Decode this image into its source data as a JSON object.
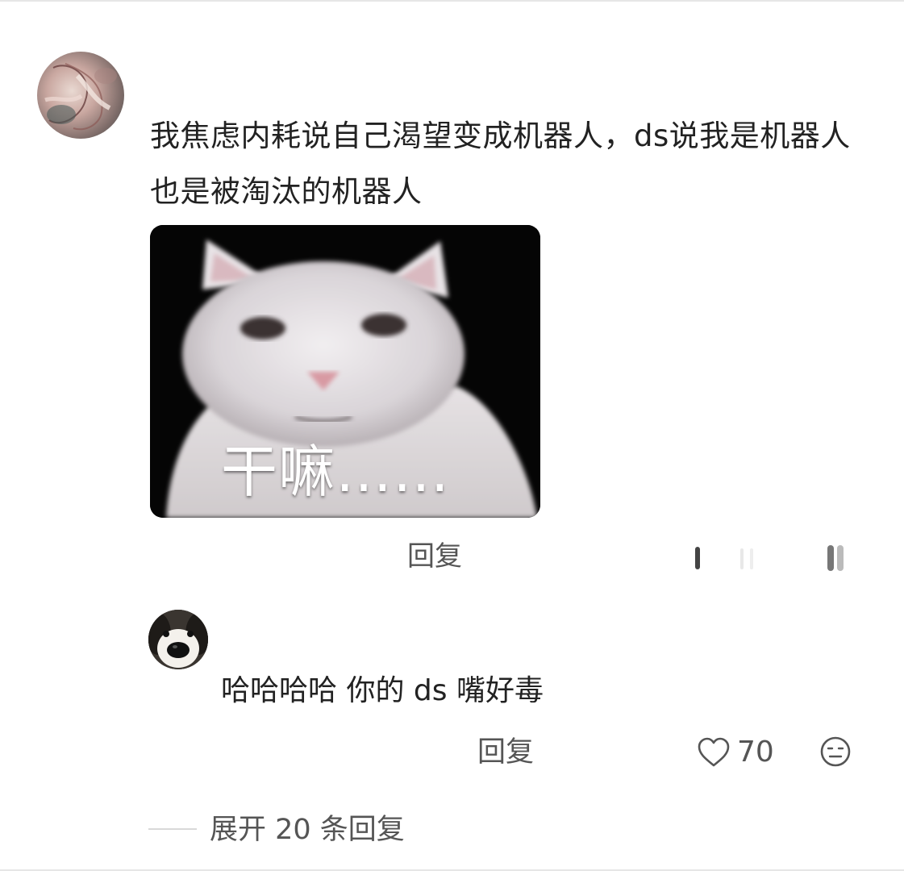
{
  "comment": {
    "avatar_icon": "user-avatar-illustration",
    "text": "我焦虑内耗说自己渴望变成机器人，ds说我是机器人也是被淘汰的机器人",
    "image": {
      "icon": "white-cat-meme",
      "caption": "干嘛……"
    },
    "reply_label": "回复"
  },
  "sub_reply": {
    "avatar_icon": "dog-avatar",
    "text": "哈哈哈哈 你的 ds 嘴好毒",
    "reply_label": "回复",
    "like_icon": "heart-outline-icon",
    "like_count": "70",
    "dislike_icon": "neutral-face-icon"
  },
  "expand": {
    "label": "展开 20 条回复"
  }
}
